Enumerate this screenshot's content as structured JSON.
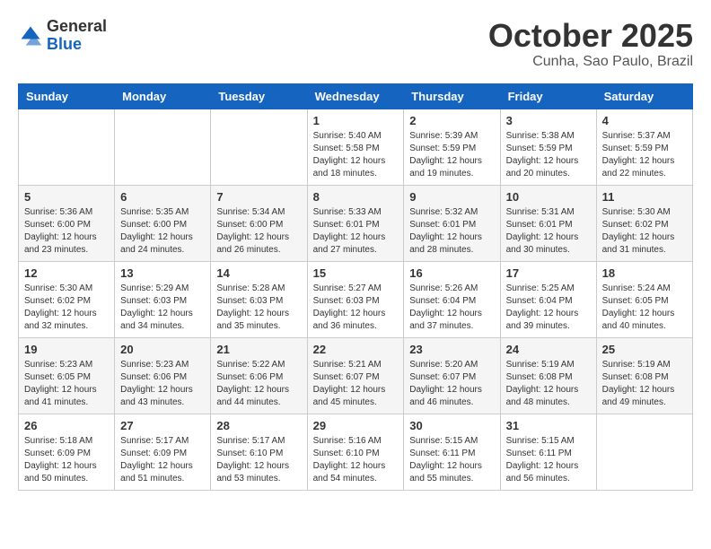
{
  "header": {
    "logo_general": "General",
    "logo_blue": "Blue",
    "month": "October 2025",
    "location": "Cunha, Sao Paulo, Brazil"
  },
  "weekdays": [
    "Sunday",
    "Monday",
    "Tuesday",
    "Wednesday",
    "Thursday",
    "Friday",
    "Saturday"
  ],
  "weeks": [
    [
      {
        "day": "",
        "sunrise": "",
        "sunset": "",
        "daylight": ""
      },
      {
        "day": "",
        "sunrise": "",
        "sunset": "",
        "daylight": ""
      },
      {
        "day": "",
        "sunrise": "",
        "sunset": "",
        "daylight": ""
      },
      {
        "day": "1",
        "sunrise": "Sunrise: 5:40 AM",
        "sunset": "Sunset: 5:58 PM",
        "daylight": "Daylight: 12 hours and 18 minutes."
      },
      {
        "day": "2",
        "sunrise": "Sunrise: 5:39 AM",
        "sunset": "Sunset: 5:59 PM",
        "daylight": "Daylight: 12 hours and 19 minutes."
      },
      {
        "day": "3",
        "sunrise": "Sunrise: 5:38 AM",
        "sunset": "Sunset: 5:59 PM",
        "daylight": "Daylight: 12 hours and 20 minutes."
      },
      {
        "day": "4",
        "sunrise": "Sunrise: 5:37 AM",
        "sunset": "Sunset: 5:59 PM",
        "daylight": "Daylight: 12 hours and 22 minutes."
      }
    ],
    [
      {
        "day": "5",
        "sunrise": "Sunrise: 5:36 AM",
        "sunset": "Sunset: 6:00 PM",
        "daylight": "Daylight: 12 hours and 23 minutes."
      },
      {
        "day": "6",
        "sunrise": "Sunrise: 5:35 AM",
        "sunset": "Sunset: 6:00 PM",
        "daylight": "Daylight: 12 hours and 24 minutes."
      },
      {
        "day": "7",
        "sunrise": "Sunrise: 5:34 AM",
        "sunset": "Sunset: 6:00 PM",
        "daylight": "Daylight: 12 hours and 26 minutes."
      },
      {
        "day": "8",
        "sunrise": "Sunrise: 5:33 AM",
        "sunset": "Sunset: 6:01 PM",
        "daylight": "Daylight: 12 hours and 27 minutes."
      },
      {
        "day": "9",
        "sunrise": "Sunrise: 5:32 AM",
        "sunset": "Sunset: 6:01 PM",
        "daylight": "Daylight: 12 hours and 28 minutes."
      },
      {
        "day": "10",
        "sunrise": "Sunrise: 5:31 AM",
        "sunset": "Sunset: 6:01 PM",
        "daylight": "Daylight: 12 hours and 30 minutes."
      },
      {
        "day": "11",
        "sunrise": "Sunrise: 5:30 AM",
        "sunset": "Sunset: 6:02 PM",
        "daylight": "Daylight: 12 hours and 31 minutes."
      }
    ],
    [
      {
        "day": "12",
        "sunrise": "Sunrise: 5:30 AM",
        "sunset": "Sunset: 6:02 PM",
        "daylight": "Daylight: 12 hours and 32 minutes."
      },
      {
        "day": "13",
        "sunrise": "Sunrise: 5:29 AM",
        "sunset": "Sunset: 6:03 PM",
        "daylight": "Daylight: 12 hours and 34 minutes."
      },
      {
        "day": "14",
        "sunrise": "Sunrise: 5:28 AM",
        "sunset": "Sunset: 6:03 PM",
        "daylight": "Daylight: 12 hours and 35 minutes."
      },
      {
        "day": "15",
        "sunrise": "Sunrise: 5:27 AM",
        "sunset": "Sunset: 6:03 PM",
        "daylight": "Daylight: 12 hours and 36 minutes."
      },
      {
        "day": "16",
        "sunrise": "Sunrise: 5:26 AM",
        "sunset": "Sunset: 6:04 PM",
        "daylight": "Daylight: 12 hours and 37 minutes."
      },
      {
        "day": "17",
        "sunrise": "Sunrise: 5:25 AM",
        "sunset": "Sunset: 6:04 PM",
        "daylight": "Daylight: 12 hours and 39 minutes."
      },
      {
        "day": "18",
        "sunrise": "Sunrise: 5:24 AM",
        "sunset": "Sunset: 6:05 PM",
        "daylight": "Daylight: 12 hours and 40 minutes."
      }
    ],
    [
      {
        "day": "19",
        "sunrise": "Sunrise: 5:23 AM",
        "sunset": "Sunset: 6:05 PM",
        "daylight": "Daylight: 12 hours and 41 minutes."
      },
      {
        "day": "20",
        "sunrise": "Sunrise: 5:23 AM",
        "sunset": "Sunset: 6:06 PM",
        "daylight": "Daylight: 12 hours and 43 minutes."
      },
      {
        "day": "21",
        "sunrise": "Sunrise: 5:22 AM",
        "sunset": "Sunset: 6:06 PM",
        "daylight": "Daylight: 12 hours and 44 minutes."
      },
      {
        "day": "22",
        "sunrise": "Sunrise: 5:21 AM",
        "sunset": "Sunset: 6:07 PM",
        "daylight": "Daylight: 12 hours and 45 minutes."
      },
      {
        "day": "23",
        "sunrise": "Sunrise: 5:20 AM",
        "sunset": "Sunset: 6:07 PM",
        "daylight": "Daylight: 12 hours and 46 minutes."
      },
      {
        "day": "24",
        "sunrise": "Sunrise: 5:19 AM",
        "sunset": "Sunset: 6:08 PM",
        "daylight": "Daylight: 12 hours and 48 minutes."
      },
      {
        "day": "25",
        "sunrise": "Sunrise: 5:19 AM",
        "sunset": "Sunset: 6:08 PM",
        "daylight": "Daylight: 12 hours and 49 minutes."
      }
    ],
    [
      {
        "day": "26",
        "sunrise": "Sunrise: 5:18 AM",
        "sunset": "Sunset: 6:09 PM",
        "daylight": "Daylight: 12 hours and 50 minutes."
      },
      {
        "day": "27",
        "sunrise": "Sunrise: 5:17 AM",
        "sunset": "Sunset: 6:09 PM",
        "daylight": "Daylight: 12 hours and 51 minutes."
      },
      {
        "day": "28",
        "sunrise": "Sunrise: 5:17 AM",
        "sunset": "Sunset: 6:10 PM",
        "daylight": "Daylight: 12 hours and 53 minutes."
      },
      {
        "day": "29",
        "sunrise": "Sunrise: 5:16 AM",
        "sunset": "Sunset: 6:10 PM",
        "daylight": "Daylight: 12 hours and 54 minutes."
      },
      {
        "day": "30",
        "sunrise": "Sunrise: 5:15 AM",
        "sunset": "Sunset: 6:11 PM",
        "daylight": "Daylight: 12 hours and 55 minutes."
      },
      {
        "day": "31",
        "sunrise": "Sunrise: 5:15 AM",
        "sunset": "Sunset: 6:11 PM",
        "daylight": "Daylight: 12 hours and 56 minutes."
      },
      {
        "day": "",
        "sunrise": "",
        "sunset": "",
        "daylight": ""
      }
    ]
  ]
}
